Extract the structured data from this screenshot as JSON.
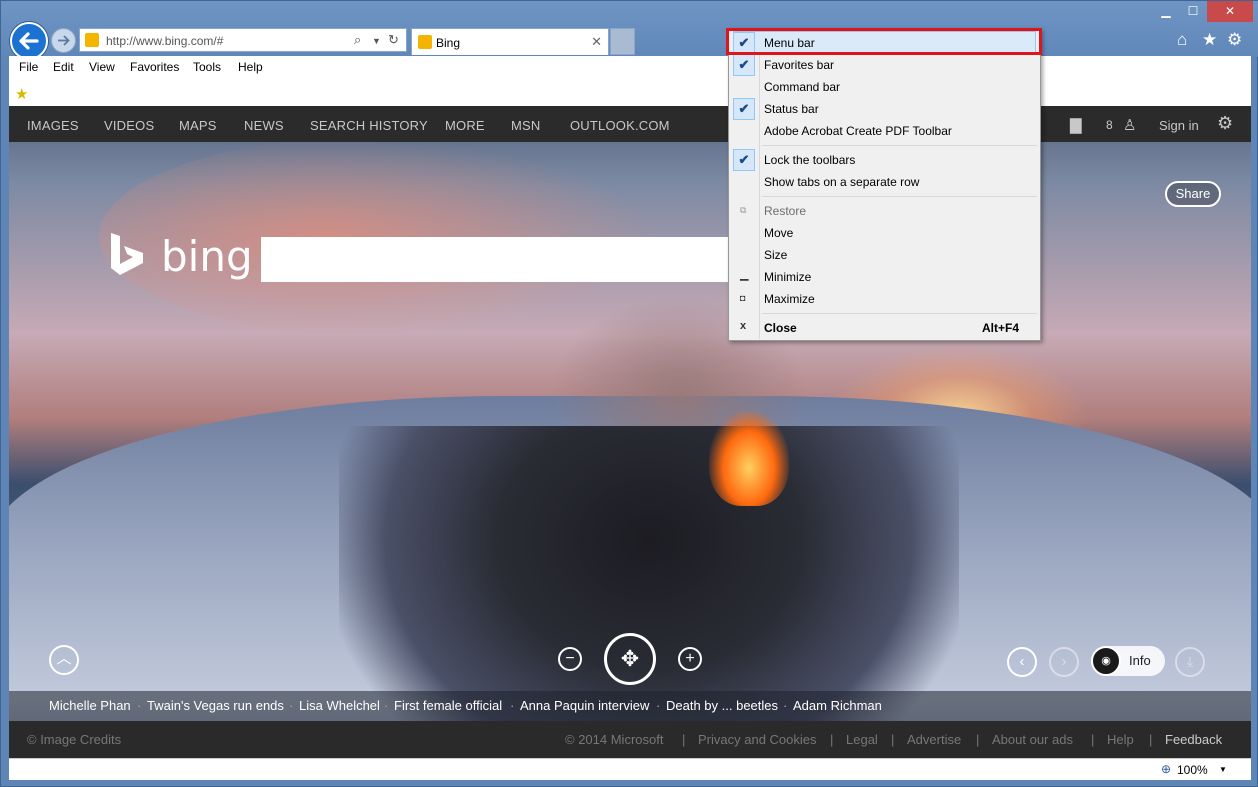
{
  "browser": {
    "address_url": "http://www.bing.com/#",
    "tab_title": "Bing",
    "zoom": "100%"
  },
  "menubar": [
    "File",
    "Edit",
    "View",
    "Favorites",
    "Tools",
    "Help"
  ],
  "bing": {
    "logo_text": "bing",
    "nav": [
      "IMAGES",
      "VIDEOS",
      "MAPS",
      "NEWS",
      "SEARCH HISTORY",
      "MORE",
      "MSN",
      "OUTLOOK.COM"
    ],
    "rewards_count": "8",
    "sign_in": "Sign in",
    "share": "Share",
    "info": "Info",
    "news": [
      "Michelle Phan",
      "Twain's Vegas run ends",
      "Lisa Whelchel",
      "First female official",
      "Anna Paquin interview",
      "Death by ... beetles",
      "Adam Richman"
    ],
    "footer_left": "© Image Credits",
    "footer_links": [
      "© 2014 Microsoft",
      "Privacy and Cookies",
      "Legal",
      "Advertise",
      "About our ads",
      "Help",
      "Feedback"
    ]
  },
  "context_menu": {
    "items": [
      {
        "label": "Menu bar",
        "checked": true
      },
      {
        "label": "Favorites bar",
        "checked": true
      },
      {
        "label": "Command bar",
        "checked": false
      },
      {
        "label": "Status bar",
        "checked": true
      },
      {
        "label": "Adobe Acrobat Create PDF Toolbar",
        "checked": false
      },
      {
        "label": "Lock the toolbars",
        "checked": true
      },
      {
        "label": "Show tabs on a separate row",
        "checked": false
      },
      {
        "label": "Restore",
        "disabled": true
      },
      {
        "label": "Move"
      },
      {
        "label": "Size"
      },
      {
        "label": "Minimize"
      },
      {
        "label": "Maximize"
      },
      {
        "label": "Close",
        "shortcut": "Alt+F4"
      }
    ]
  }
}
